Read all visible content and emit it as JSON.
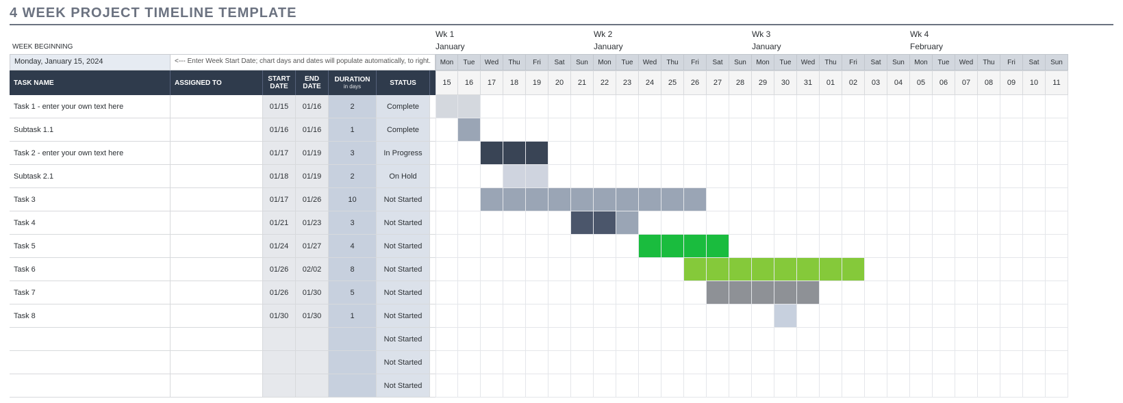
{
  "title": "4 WEEK PROJECT TIMELINE TEMPLATE",
  "week_beginning_label": "WEEK BEGINNING",
  "week_beginning_value": "Monday, January 15, 2024",
  "week_beginning_note": "<--- Enter Week Start Date; chart days and dates will populate automatically, to right.",
  "columns": {
    "task": "TASK NAME",
    "assigned": "ASSIGNED TO",
    "start": "START DATE",
    "end": "END DATE",
    "duration": "DURATION",
    "duration_sub": "in days",
    "status": "STATUS"
  },
  "weeks": [
    {
      "label": "Wk 1",
      "month": "January"
    },
    {
      "label": "Wk 2",
      "month": "January"
    },
    {
      "label": "Wk 3",
      "month": "January"
    },
    {
      "label": "Wk 4",
      "month": "February"
    }
  ],
  "days": [
    {
      "dow": "Mon",
      "dom": "15"
    },
    {
      "dow": "Tue",
      "dom": "16"
    },
    {
      "dow": "Wed",
      "dom": "17"
    },
    {
      "dow": "Thu",
      "dom": "18"
    },
    {
      "dow": "Fri",
      "dom": "19"
    },
    {
      "dow": "Sat",
      "dom": "20"
    },
    {
      "dow": "Sun",
      "dom": "21"
    },
    {
      "dow": "Mon",
      "dom": "22"
    },
    {
      "dow": "Tue",
      "dom": "23"
    },
    {
      "dow": "Wed",
      "dom": "24"
    },
    {
      "dow": "Thu",
      "dom": "25"
    },
    {
      "dow": "Fri",
      "dom": "26"
    },
    {
      "dow": "Sat",
      "dom": "27"
    },
    {
      "dow": "Sun",
      "dom": "28"
    },
    {
      "dow": "Mon",
      "dom": "29"
    },
    {
      "dow": "Tue",
      "dom": "30"
    },
    {
      "dow": "Wed",
      "dom": "31"
    },
    {
      "dow": "Thu",
      "dom": "01"
    },
    {
      "dow": "Fri",
      "dom": "02"
    },
    {
      "dow": "Sat",
      "dom": "03"
    },
    {
      "dow": "Sun",
      "dom": "04"
    },
    {
      "dow": "Mon",
      "dom": "05"
    },
    {
      "dow": "Tue",
      "dom": "06"
    },
    {
      "dow": "Wed",
      "dom": "07"
    },
    {
      "dow": "Thu",
      "dom": "08"
    },
    {
      "dow": "Fri",
      "dom": "09"
    },
    {
      "dow": "Sat",
      "dom": "10"
    },
    {
      "dow": "Sun",
      "dom": "11"
    }
  ],
  "tasks": [
    {
      "name": "Task 1 - enter your own text here",
      "assigned": "",
      "start": "01/15",
      "end": "01/16",
      "duration": "2",
      "status": "Complete",
      "bar_start": 0,
      "bar_len": 2,
      "color": "bar-grey"
    },
    {
      "name": "Subtask 1.1",
      "assigned": "",
      "start": "01/16",
      "end": "01/16",
      "duration": "1",
      "status": "Complete",
      "bar_start": 1,
      "bar_len": 1,
      "color": "bar-slate"
    },
    {
      "name": "Task 2 - enter your own text here",
      "assigned": "",
      "start": "01/17",
      "end": "01/19",
      "duration": "3",
      "status": "In Progress",
      "bar_start": 2,
      "bar_len": 3,
      "color": "bar-dark"
    },
    {
      "name": "Subtask 2.1",
      "assigned": "",
      "start": "01/18",
      "end": "01/19",
      "duration": "2",
      "status": "On Hold",
      "bar_start": 3,
      "bar_len": 2,
      "color": "bar-mute"
    },
    {
      "name": "Task 3",
      "assigned": "",
      "start": "01/17",
      "end": "01/26",
      "duration": "10",
      "status": "Not Started",
      "bar_start": 2,
      "bar_len": 10,
      "color": "bar-slate"
    },
    {
      "name": "Task 4",
      "assigned": "",
      "start": "01/21",
      "end": "01/23",
      "duration": "3",
      "status": "Not Started",
      "bar_start": 6,
      "bar_len": 3,
      "color": "bar-steel",
      "tail": "bar-steel-l"
    },
    {
      "name": "Task 5",
      "assigned": "",
      "start": "01/24",
      "end": "01/27",
      "duration": "4",
      "status": "Not Started",
      "bar_start": 9,
      "bar_len": 4,
      "color": "bar-green"
    },
    {
      "name": "Task 6",
      "assigned": "",
      "start": "01/26",
      "end": "02/02",
      "duration": "8",
      "status": "Not Started",
      "bar_start": 11,
      "bar_len": 8,
      "color": "bar-lime"
    },
    {
      "name": "Task 7",
      "assigned": "",
      "start": "01/26",
      "end": "01/30",
      "duration": "5",
      "status": "Not Started",
      "bar_start": 12,
      "bar_len": 5,
      "color": "bar-gray2"
    },
    {
      "name": "Task 8",
      "assigned": "",
      "start": "01/30",
      "end": "01/30",
      "duration": "1",
      "status": "Not Started",
      "bar_start": 15,
      "bar_len": 1,
      "color": "bar-pale"
    },
    {
      "name": "",
      "assigned": "",
      "start": "",
      "end": "",
      "duration": "",
      "status": "Not Started",
      "bar_start": -1,
      "bar_len": 0,
      "color": ""
    },
    {
      "name": "",
      "assigned": "",
      "start": "",
      "end": "",
      "duration": "",
      "status": "Not Started",
      "bar_start": -1,
      "bar_len": 0,
      "color": ""
    },
    {
      "name": "",
      "assigned": "",
      "start": "",
      "end": "",
      "duration": "",
      "status": "Not Started",
      "bar_start": -1,
      "bar_len": 0,
      "color": ""
    }
  ],
  "chart_data": {
    "type": "gantt",
    "title": "4 WEEK PROJECT TIMELINE TEMPLATE",
    "x_start": "2024-01-15",
    "x_end": "2024-02-11",
    "series": [
      {
        "name": "Task 1 - enter your own text here",
        "start": "2024-01-15",
        "end": "2024-01-16",
        "duration_days": 2,
        "status": "Complete"
      },
      {
        "name": "Subtask 1.1",
        "start": "2024-01-16",
        "end": "2024-01-16",
        "duration_days": 1,
        "status": "Complete"
      },
      {
        "name": "Task 2 - enter your own text here",
        "start": "2024-01-17",
        "end": "2024-01-19",
        "duration_days": 3,
        "status": "In Progress"
      },
      {
        "name": "Subtask 2.1",
        "start": "2024-01-18",
        "end": "2024-01-19",
        "duration_days": 2,
        "status": "On Hold"
      },
      {
        "name": "Task 3",
        "start": "2024-01-17",
        "end": "2024-01-26",
        "duration_days": 10,
        "status": "Not Started"
      },
      {
        "name": "Task 4",
        "start": "2024-01-21",
        "end": "2024-01-23",
        "duration_days": 3,
        "status": "Not Started"
      },
      {
        "name": "Task 5",
        "start": "2024-01-24",
        "end": "2024-01-27",
        "duration_days": 4,
        "status": "Not Started"
      },
      {
        "name": "Task 6",
        "start": "2024-01-26",
        "end": "2024-02-02",
        "duration_days": 8,
        "status": "Not Started"
      },
      {
        "name": "Task 7",
        "start": "2024-01-26",
        "end": "2024-01-30",
        "duration_days": 5,
        "status": "Not Started"
      },
      {
        "name": "Task 8",
        "start": "2024-01-30",
        "end": "2024-01-30",
        "duration_days": 1,
        "status": "Not Started"
      }
    ]
  }
}
